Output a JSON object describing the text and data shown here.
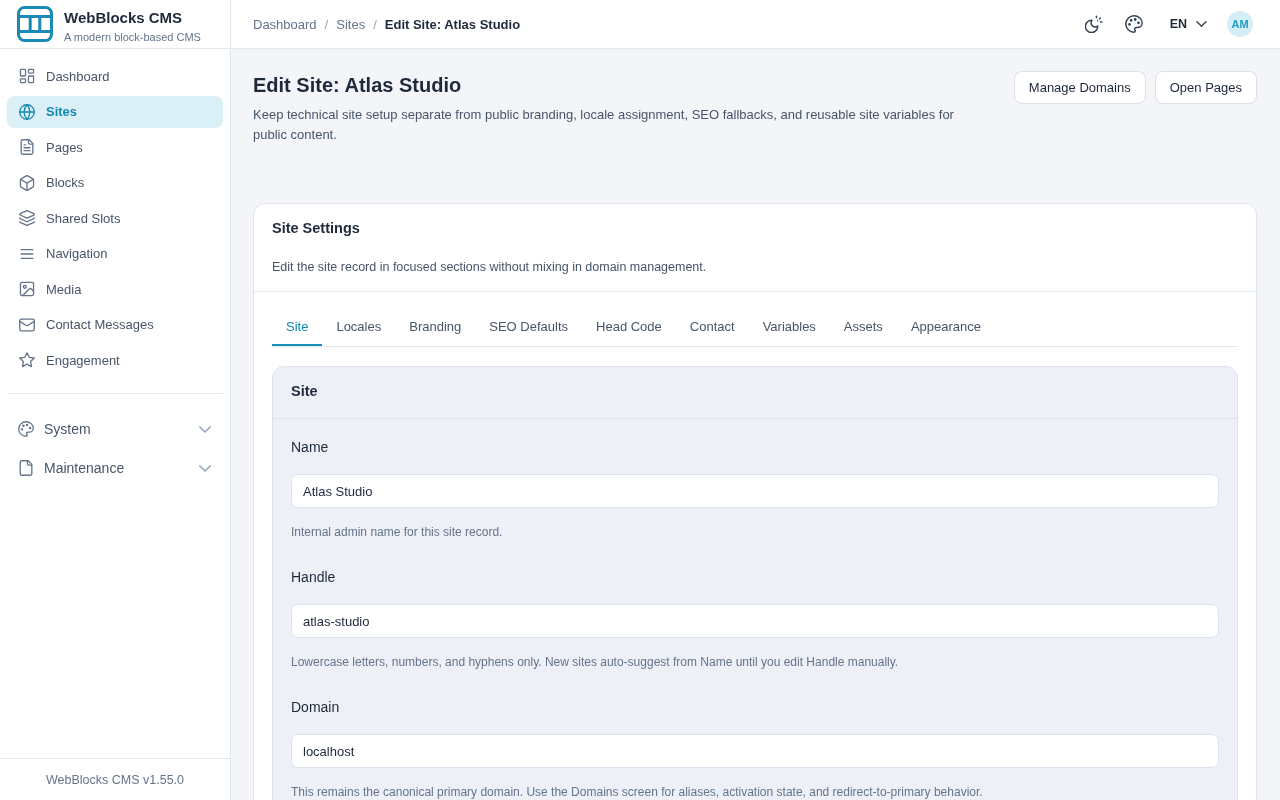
{
  "sidebar": {
    "brand": {
      "title": "WebBlocks CMS",
      "subtitle": "A modern block-based CMS"
    },
    "items": [
      {
        "label": "Dashboard",
        "selected": false
      },
      {
        "label": "Sites",
        "selected": true
      },
      {
        "label": "Pages",
        "selected": false
      },
      {
        "label": "Blocks",
        "selected": false
      },
      {
        "label": "Shared Slots",
        "selected": false
      },
      {
        "label": "Navigation",
        "selected": false
      },
      {
        "label": "Media",
        "selected": false
      },
      {
        "label": "Contact Messages",
        "selected": false
      },
      {
        "label": "Engagement",
        "selected": false
      }
    ],
    "groups": [
      {
        "label": "System",
        "expanded": false
      },
      {
        "label": "Maintenance",
        "expanded": false
      }
    ],
    "footer": "WebBlocks CMS v1.55.0"
  },
  "topbar": {
    "breadcrumbs": [
      {
        "kind": "link",
        "text": "Dashboard"
      },
      {
        "kind": "separator",
        "text": "/"
      },
      {
        "kind": "link",
        "text": "Sites"
      },
      {
        "kind": "separator",
        "text": "/"
      },
      {
        "kind": "current",
        "text": "Edit Site: Atlas Studio"
      }
    ],
    "language": "EN",
    "avatar": "AM"
  },
  "page": {
    "title": "Edit Site: Atlas Studio",
    "description": "Keep technical site setup separate from public branding, locale assignment, SEO fallbacks, and reusable site variables for public content.",
    "actions": [
      "Manage Domains",
      "Open Pages"
    ]
  },
  "settings": {
    "title": "Site Settings",
    "description": "Edit the site record in focused sections without mixing in domain management.",
    "tabs": [
      {
        "label": "Site",
        "selected": true
      },
      {
        "label": "Locales",
        "selected": false
      },
      {
        "label": "Branding",
        "selected": false
      },
      {
        "label": "SEO Defaults",
        "selected": false
      },
      {
        "label": "Head Code",
        "selected": false
      },
      {
        "label": "Contact",
        "selected": false
      },
      {
        "label": "Variables",
        "selected": false
      },
      {
        "label": "Assets",
        "selected": false
      },
      {
        "label": "Appearance",
        "selected": false
      }
    ],
    "section": {
      "title": "Site",
      "fields": [
        {
          "label": "Name",
          "value": "Atlas Studio",
          "help": "Internal admin name for this site record."
        },
        {
          "label": "Handle",
          "value": "atlas-studio",
          "help": "Lowercase letters, numbers, and hyphens only. New sites auto-suggest from Name until you edit Handle manually."
        },
        {
          "label": "Domain",
          "value": "localhost",
          "help": "This remains the canonical primary domain. Use the Domains screen for aliases, activation state, and redirect-to-primary behavior."
        }
      ]
    }
  }
}
